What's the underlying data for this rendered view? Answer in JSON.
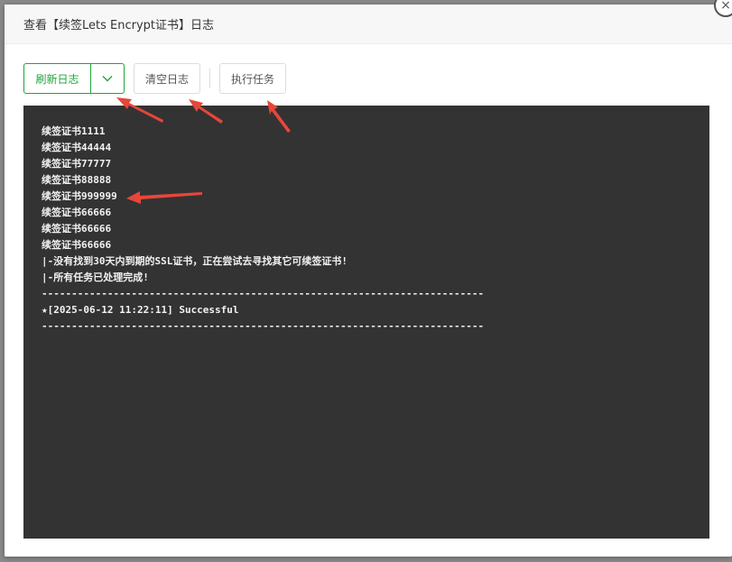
{
  "dialog": {
    "title": "查看【续签Lets Encrypt证书】日志",
    "close_glyph": "×"
  },
  "toolbar": {
    "refresh_label": "刷新日志",
    "clear_label": "清空日志",
    "execute_label": "执行任务"
  },
  "log": {
    "lines": [
      "续签证书1111",
      "续签证书44444",
      "续签证书77777",
      "续签证书88888",
      "续签证书999999",
      "续签证书66666",
      "续签证书66666",
      "续签证书66666",
      "|-没有找到30天内到期的SSL证书，正在尝试去寻找其它可续签证书!",
      "|-所有任务已处理完成!",
      "--------------------------------------------------------------------------",
      "★[2025-06-12 11:22:11] Successful",
      "--------------------------------------------------------------------------"
    ]
  },
  "colors": {
    "accent": "#20a53a",
    "log_bg": "#333333",
    "annotation_arrow": "#e8463a"
  }
}
